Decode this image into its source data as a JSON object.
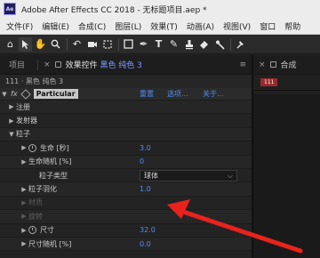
{
  "titlebar": {
    "app_icon": "Ae",
    "title": "Adobe After Effects CC 2018 - 无标题项目.aep *"
  },
  "menu": [
    "文件(F)",
    "编辑(E)",
    "合成(C)",
    "图层(L)",
    "效果(T)",
    "动画(A)",
    "视图(V)",
    "窗口",
    "帮助"
  ],
  "toolbar": {
    "tools": [
      "home-icon",
      "hand-icon",
      "zoom-icon",
      "rotate-icon",
      "camera-orbit-icon",
      "pan-behind-icon",
      "rectangle-icon",
      "pen-icon",
      "type-icon",
      "brush-icon",
      "clone-stamp-icon",
      "eraser-icon",
      "roto-brush-icon",
      "puppet-pin-icon"
    ]
  },
  "left_panel": {
    "tab_project": "项目",
    "tab_close": "×",
    "tab_effects_prefix": "效果控件 ",
    "tab_effects_layer": "黑色 纯色 3",
    "tab_menu": "≡",
    "breadcrumb": "111 · 黑色 纯色 3",
    "fx_label": "fx",
    "effect_name": "Particular",
    "effect_reset": "重置",
    "effect_options": "选项...",
    "effect_about": "关于..."
  },
  "properties": [
    {
      "label": "注册",
      "indent": 1,
      "arrow": "▶"
    },
    {
      "label": "发射器",
      "indent": 1,
      "arrow": "▶"
    },
    {
      "label": "粒子",
      "indent": 1,
      "arrow": "▼"
    },
    {
      "label": "生命 [秒]",
      "indent": 2,
      "arrow": "▶",
      "stopwatch": true,
      "value": "3.0"
    },
    {
      "label": "生命随机 [%]",
      "indent": 2,
      "arrow": "▶",
      "value": "0"
    },
    {
      "label": "粒子类型",
      "indent": 3,
      "dropdown": "球体"
    },
    {
      "label": "粒子羽化",
      "indent": 2,
      "arrow": "▶",
      "value": "1.0"
    },
    {
      "label": "材质",
      "indent": 2,
      "arrow": "▶",
      "dim": true
    },
    {
      "label": "旋转",
      "indent": 2,
      "arrow": "▶",
      "dim": true
    },
    {
      "label": "尺寸",
      "indent": 2,
      "arrow": "▶",
      "stopwatch": true,
      "value": "32.0"
    },
    {
      "label": "尺寸随机 [%]",
      "indent": 2,
      "arrow": "▶",
      "value": "0.0"
    }
  ],
  "right_panel": {
    "tab_close": "×",
    "tab_label": "合成",
    "comp_badge": "111"
  },
  "colors": {
    "value_blue": "#4f8dff",
    "annotation_arrow": "#e8231b"
  }
}
